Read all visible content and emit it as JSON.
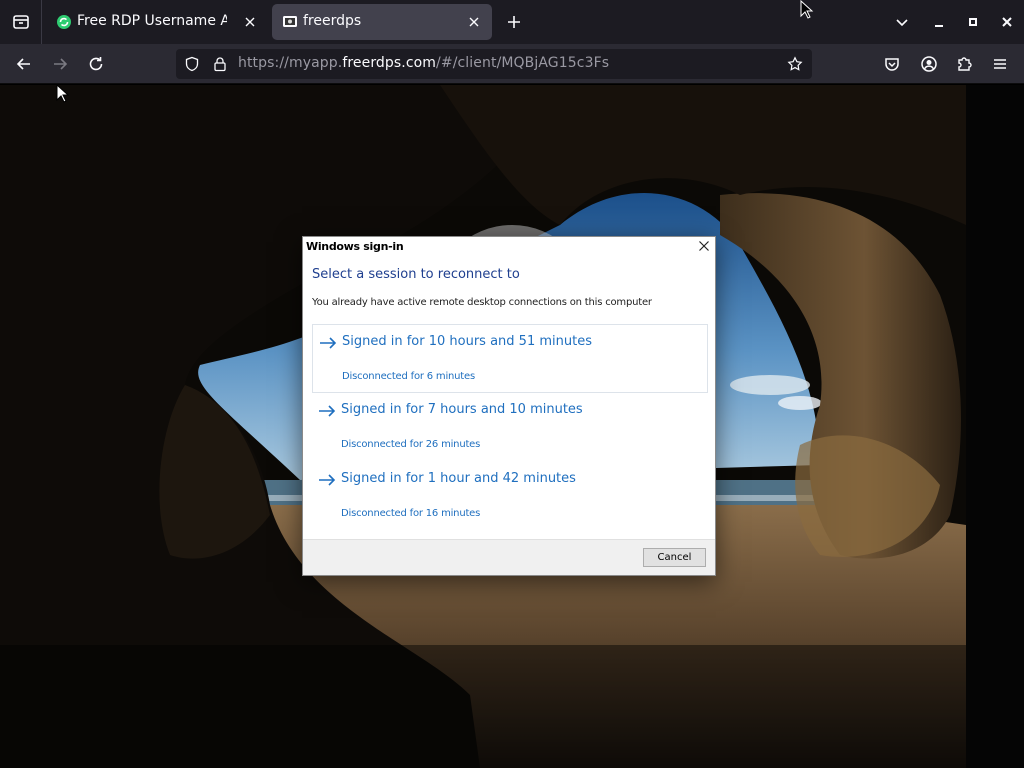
{
  "browser": {
    "tabs": [
      {
        "title": "Free RDP Username And",
        "active": false
      },
      {
        "title": "freerdps",
        "active": true
      }
    ],
    "url": {
      "scheme_prefix": "https://myapp.",
      "domain": "freerdps.com",
      "path": "/#/client/MQBjAG15c3Fs"
    },
    "icons": {
      "tab_list": "tab-list-icon",
      "new_tab": "plus-icon",
      "back": "arrow-left-icon",
      "forward": "arrow-right-icon",
      "reload": "reload-icon",
      "shield": "shield-icon",
      "lock": "lock-icon",
      "bookmark": "star-icon",
      "pocket": "pocket-icon",
      "account": "account-icon",
      "extensions": "puzzle-icon",
      "menu": "hamburger-icon"
    },
    "colors": {
      "tabbar": "#1c1b22",
      "toolbar": "#2b2a33",
      "active_tab": "#42414d"
    }
  },
  "dialog": {
    "title": "Windows sign-in",
    "heading": "Select a session to reconnect to",
    "subtitle": "You already have active remote desktop connections on this computer",
    "sessions": [
      {
        "label": "Signed in for 10 hours and 51 minutes",
        "detail": "Disconnected for 6 minutes"
      },
      {
        "label": "Signed in for 7 hours and 10 minutes",
        "detail": "Disconnected for 26 minutes"
      },
      {
        "label": "Signed in for 1 hour and 42 minutes",
        "detail": "Disconnected for 16 minutes"
      }
    ],
    "cancel_label": "Cancel",
    "colors": {
      "heading": "#1f3f8f",
      "link": "#1f6fbf"
    }
  }
}
